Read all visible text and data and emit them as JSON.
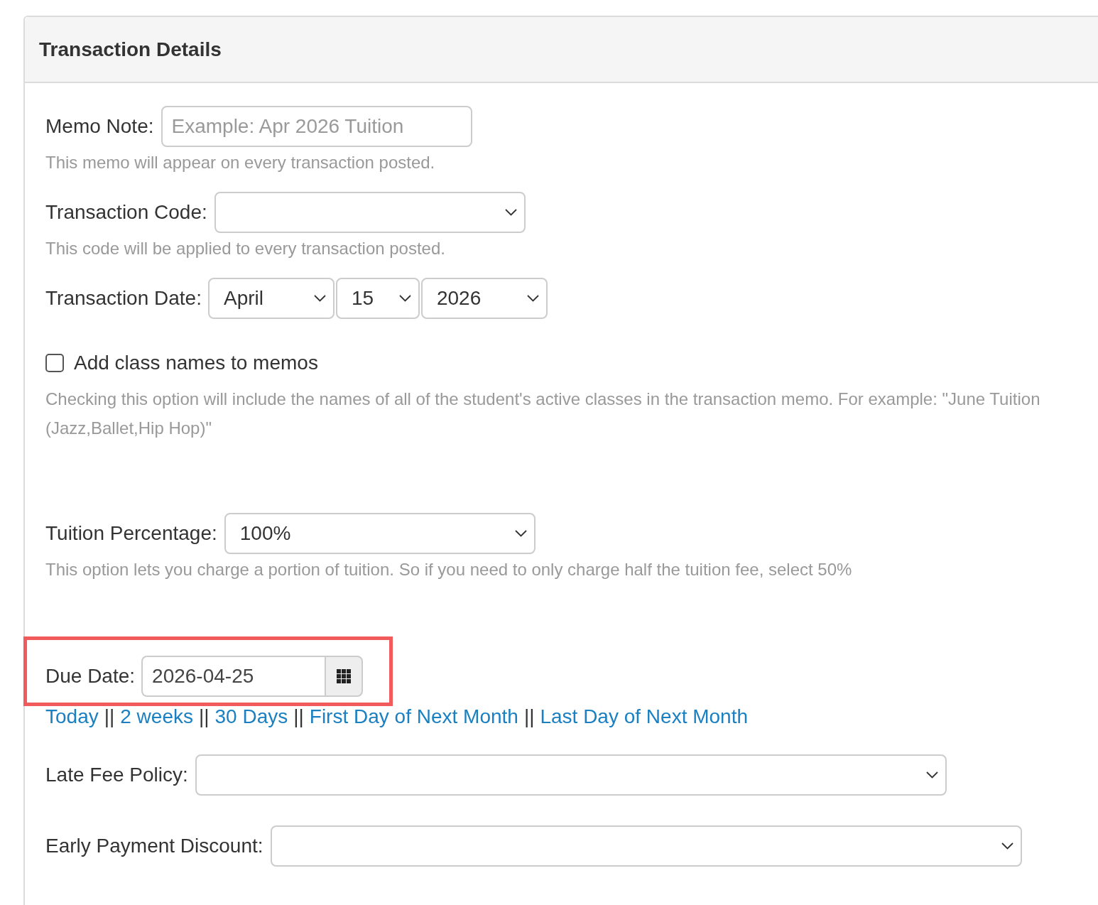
{
  "panel": {
    "title": "Transaction Details"
  },
  "memo_note": {
    "label": "Memo Note:",
    "placeholder": "Example: Apr 2026 Tuition",
    "help": "This memo will appear on every transaction posted."
  },
  "transaction_code": {
    "label": "Transaction Code:",
    "help": "This code will be applied to every transaction posted."
  },
  "transaction_date": {
    "label": "Transaction Date:",
    "month": "April",
    "day": "15",
    "year": "2026"
  },
  "add_class_names": {
    "label": "Add class names to memos",
    "checked": false,
    "help": "Checking this option will include the names of all of the student's active classes in the transaction memo. For example: \"June Tuition (Jazz,Ballet,Hip Hop)\""
  },
  "tuition_percentage": {
    "label": "Tuition Percentage:",
    "value": "100%",
    "help": "This option lets you charge a portion of tuition. So if you need to only charge half the tuition fee, select 50%"
  },
  "due_date": {
    "label": "Due Date:",
    "value": "2026-04-25",
    "highlighted": true,
    "shortcuts": [
      {
        "kind": "link",
        "text": "Today"
      },
      {
        "kind": "separator",
        "text": "||"
      },
      {
        "kind": "link",
        "text": "2 weeks"
      },
      {
        "kind": "separator",
        "text": "||"
      },
      {
        "kind": "link",
        "text": "30 Days"
      },
      {
        "kind": "separator",
        "text": "||"
      },
      {
        "kind": "link",
        "text": "First Day of Next Month"
      },
      {
        "kind": "separator",
        "text": "||"
      },
      {
        "kind": "link",
        "text": "Last Day of Next Month"
      }
    ]
  },
  "late_fee_policy": {
    "label": "Late Fee Policy:"
  },
  "early_payment_discount": {
    "label": "Early Payment Discount:"
  }
}
